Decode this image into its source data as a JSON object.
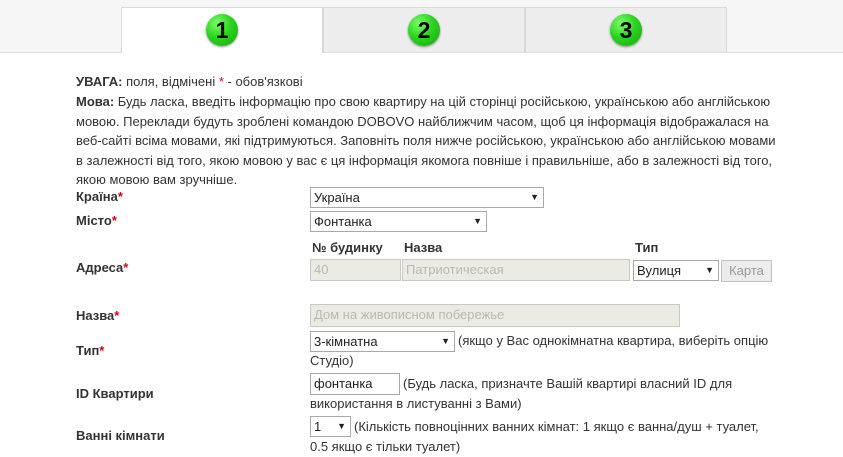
{
  "steps": [
    {
      "number": "1"
    },
    {
      "number": "2"
    },
    {
      "number": "3"
    }
  ],
  "notice": {
    "warning_label": "УВАГА:",
    "warning_text": " поля, відмічені ",
    "required_mark": "*",
    "warning_suffix": " - обов'язкові",
    "language_label": "Мова:",
    "language_text": " Будь ласка, введіть інформацію про свою квартиру на цій сторінці російською, українською або англійською мовою. Переклади будуть зроблені командою DOBOVO найближчим часом, щоб ця інформація відображалася на веб-сайті всіма мовами, які підтримуються. Заповніть поля нижче російською, українською або англійською мовами в залежності від того, якою мовою у вас є ця інформація якомога повніше і правильніше, або в залежності від того, якою мовою вам зручніше."
  },
  "form": {
    "country": {
      "label": "Країна",
      "value": "Україна"
    },
    "city": {
      "label": "Місто",
      "value": "Фонтанка"
    },
    "address": {
      "label": "Адреса",
      "house_header": "№ будинку",
      "name_header": "Назва",
      "type_header": "Тип",
      "house_value": "40",
      "street_value": "Патриотическая",
      "street_type": "Вулиця",
      "map_button": "Карта"
    },
    "name": {
      "label": "Назва",
      "value": "Дом на живописном побережье"
    },
    "type": {
      "label": "Тип",
      "value": "3-кімнатна",
      "hint": "(якщо у Вас однокімнатна квартира, виберіть опцію Студіо)"
    },
    "apartment_id": {
      "label": "ID Квартири",
      "value": "фонтанка",
      "hint": "(Будь ласка, призначте Вашій квартирі власний ID для використання в листуванні з Вами)"
    },
    "bathrooms": {
      "label": "Ванні кімнати",
      "value": "1",
      "hint": "(Кількість повноцінних ванних кімнат: 1 якщо є ванна/душ + туалет, 0.5 якщо є тільки туалет)"
    }
  }
}
